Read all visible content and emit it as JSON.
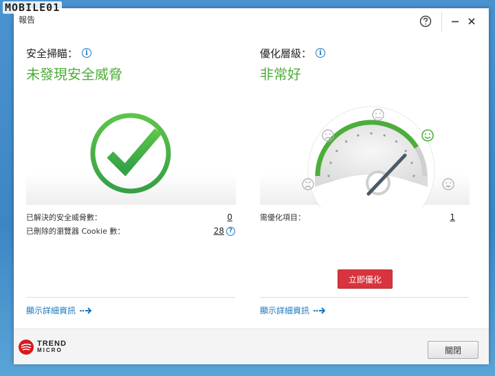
{
  "watermark": "MOBILE01",
  "window": {
    "title": "報告"
  },
  "scan": {
    "heading": "安全掃瞄：",
    "status": "未發現安全威脅",
    "stats": [
      {
        "label": "已解決的安全威脅數：",
        "value": "0"
      },
      {
        "label": "已刪除的瀏覽器 Cookie 數：",
        "value": "28"
      }
    ],
    "details_link": "顯示詳細資訊"
  },
  "optimization": {
    "heading": "優化層級：",
    "status": "非常好",
    "stats": [
      {
        "label": "需優化項目：",
        "value": "1"
      }
    ],
    "action_button": "立即優化",
    "details_link": "顯示詳細資訊",
    "gauge_level": 0.82
  },
  "footer": {
    "brand_line1": "TREND",
    "brand_line2": "MICRO",
    "close_button": "關閉"
  },
  "colors": {
    "accent_green": "#4cae3a",
    "link_blue": "#1b76bc",
    "action_red": "#d9343d",
    "brand_red": "#d71920"
  },
  "icons": {
    "help": "question-circle-icon",
    "minimize": "minimize-icon",
    "close": "close-x-icon",
    "info": "info-icon",
    "check": "checkmark-circle-icon",
    "gauge": "speedometer-icon",
    "arrow": "arrow-right-icon"
  }
}
